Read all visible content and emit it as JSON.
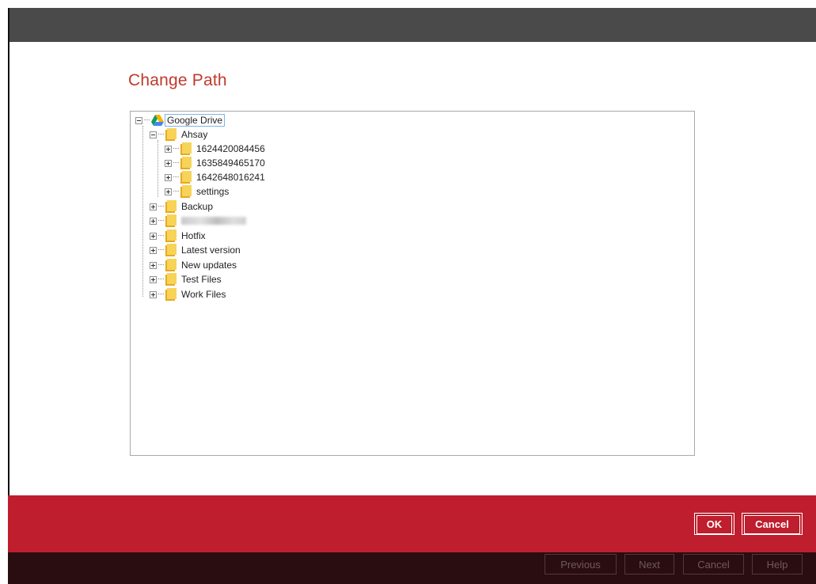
{
  "dialog": {
    "title": "Change Path",
    "ok_label": "OK",
    "cancel_label": "Cancel"
  },
  "tree": {
    "root": "Google Drive",
    "ahsay": "Ahsay",
    "ahsay_children": [
      "1624420084456",
      "1635849465170",
      "1642648016241",
      "settings"
    ],
    "backup": "Backup",
    "hotfix": "Hotfix",
    "latest_version": "Latest version",
    "new_updates": "New updates",
    "test_files": "Test Files",
    "work_files": "Work Files"
  },
  "wizard_nav": {
    "previous": "Previous",
    "next": "Next",
    "cancel": "Cancel",
    "help": "Help"
  },
  "colors": {
    "accent_red": "#be1e2d",
    "title_red": "#c0392b",
    "folder_yellow": "#f2c12e"
  }
}
